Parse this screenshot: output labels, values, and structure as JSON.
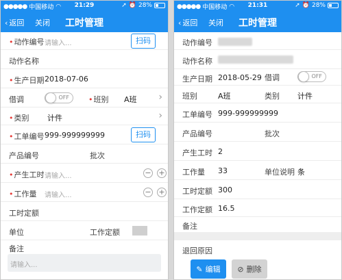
{
  "left": {
    "status": {
      "carrier": "中国移动",
      "time": "21:29",
      "battery": "28%"
    },
    "nav": {
      "back": "返回",
      "close": "关闭",
      "title": "工时管理"
    },
    "fields": {
      "action_code": {
        "label": "动作编号",
        "placeholder": "请输入..."
      },
      "scan1": "扫码",
      "action_name": {
        "label": "动作名称"
      },
      "prod_date": {
        "label": "生产日期",
        "value": "2018-07-06"
      },
      "borrow": {
        "label": "借调",
        "toggle": "OFF"
      },
      "shift": {
        "label": "班别",
        "value": "A班"
      },
      "category": {
        "label": "类别",
        "value": "计件"
      },
      "work_order": {
        "label": "工单编号",
        "value": "999-999999999"
      },
      "scan2": "扫码",
      "product_code": {
        "label": "产品编号",
        "batch_label": "批次"
      },
      "output_hours": {
        "label": "产生工时",
        "placeholder": "请输入..."
      },
      "workload": {
        "label": "工作量",
        "placeholder": "请输入..."
      },
      "quota": {
        "label": "工时定额"
      },
      "unit": {
        "label": "单位",
        "quota_label": "工作定额"
      },
      "remarks": {
        "label": "备注",
        "placeholder": "请输入..."
      }
    }
  },
  "right": {
    "status": {
      "carrier": "中国移动",
      "time": "21:31",
      "battery": "28%"
    },
    "nav": {
      "back": "返回",
      "close": "关闭",
      "title": "工时管理"
    },
    "fields": {
      "action_code": {
        "label": "动作编号"
      },
      "action_name": {
        "label": "动作名称"
      },
      "prod_date": {
        "label": "生产日期",
        "value": "2018-05-29"
      },
      "borrow": {
        "label": "借调",
        "toggle": "OFF"
      },
      "shift": {
        "label": "班别",
        "value": "A班"
      },
      "category": {
        "label": "类别",
        "value": "计件"
      },
      "work_order": {
        "label": "工单编号",
        "value": "999-999999999"
      },
      "product_code": {
        "label": "产品编号",
        "batch_label": "批次"
      },
      "output_hours": {
        "label": "产生工时",
        "value": "2"
      },
      "workload": {
        "label": "工作量",
        "value": "33",
        "unit_label": "单位说明",
        "unit_value": "条"
      },
      "hours_quota": {
        "label": "工时定额",
        "value": "300"
      },
      "work_quota": {
        "label": "工作定额",
        "value": "16.5"
      },
      "remarks": {
        "label": "备注"
      },
      "return_reason": {
        "label": "退回原因"
      }
    },
    "buttons": {
      "edit": "编辑",
      "delete": "删除"
    }
  }
}
